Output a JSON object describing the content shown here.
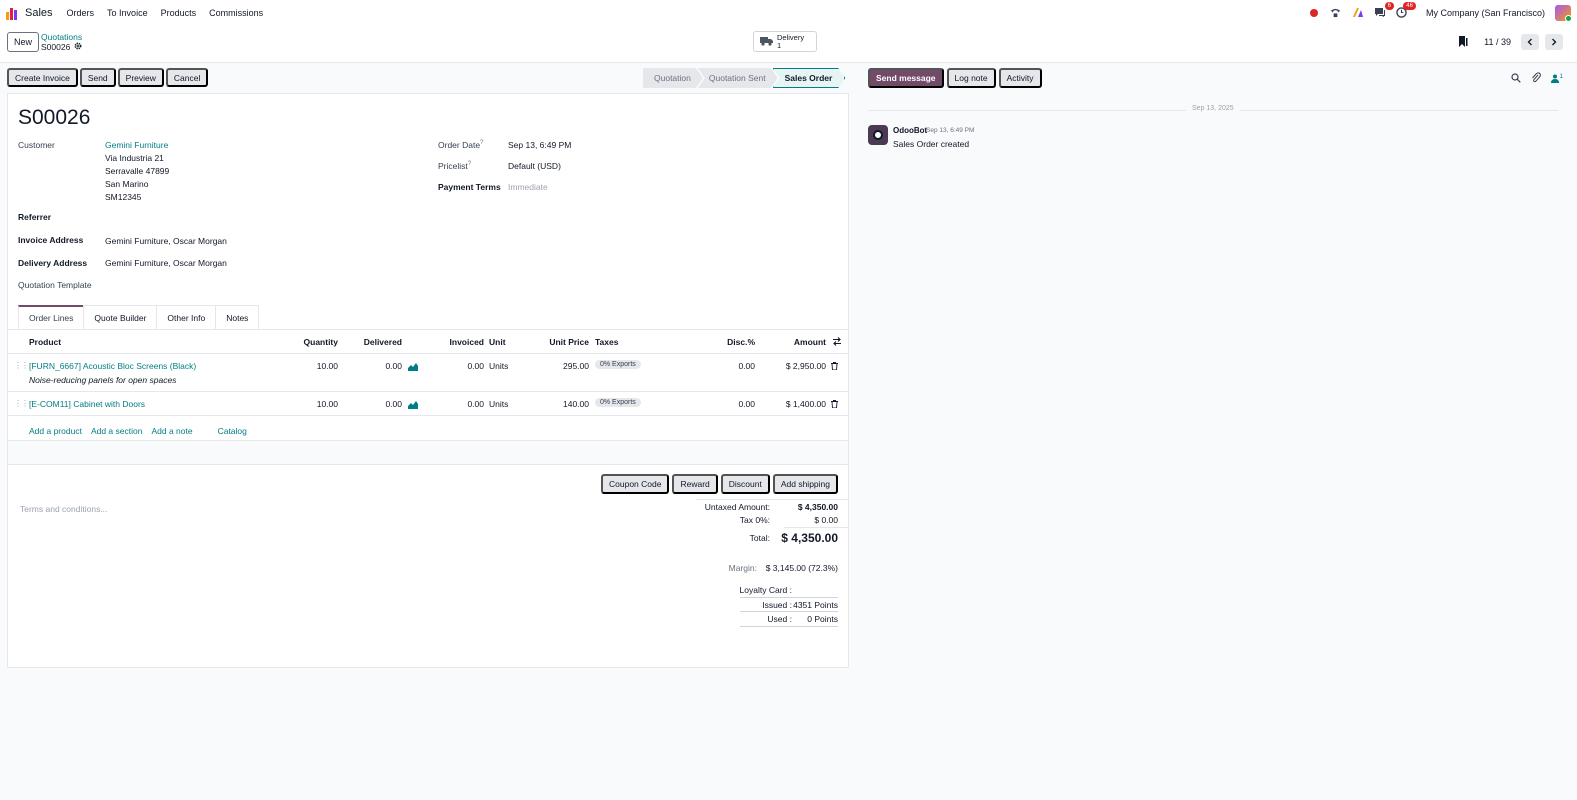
{
  "navbar": {
    "app_name": "Sales",
    "menu": [
      "Orders",
      "To Invoice",
      "Products",
      "Commissions"
    ],
    "chat_badge": "6",
    "activity_badge": "46",
    "company": "My Company (San Francisco)"
  },
  "control": {
    "new_label": "New",
    "breadcrumb_parent": "Quotations",
    "breadcrumb_current": "S00026",
    "delivery_label": "Delivery",
    "delivery_count": "1",
    "pager": "11 / 39"
  },
  "actions": {
    "create_invoice": "Create Invoice",
    "send": "Send",
    "preview": "Preview",
    "cancel": "Cancel"
  },
  "statuses": [
    "Quotation",
    "Quotation Sent",
    "Sales Order"
  ],
  "form": {
    "name": "S00026",
    "customer_label": "Customer",
    "customer_name": "Gemini Furniture",
    "customer_address": [
      "Via Industria 21",
      "Serravalle 47899",
      "San Marino",
      "SM12345"
    ],
    "referrer_label": "Referrer",
    "invoice_address_label": "Invoice Address",
    "invoice_address": "Gemini Furniture, Oscar Morgan",
    "delivery_address_label": "Delivery Address",
    "delivery_address": "Gemini Furniture, Oscar Morgan",
    "quotation_template_label": "Quotation Template",
    "order_date_label": "Order Date",
    "order_date": "Sep 13, 6:49 PM",
    "pricelist_label": "Pricelist",
    "pricelist": "Default (USD)",
    "payment_terms_label": "Payment Terms",
    "payment_terms_placeholder": "Immediate",
    "help_mark": "?"
  },
  "tabs": [
    "Order Lines",
    "Quote Builder",
    "Other Info",
    "Notes"
  ],
  "table": {
    "headers": {
      "product": "Product",
      "quantity": "Quantity",
      "delivered": "Delivered",
      "invoiced": "Invoiced",
      "unit": "Unit",
      "unit_price": "Unit Price",
      "taxes": "Taxes",
      "disc": "Disc.%",
      "amount": "Amount"
    },
    "rows": [
      {
        "product": "[FURN_6667] Acoustic Bloc Screens (Black)",
        "description": "Noise-reducing panels for open spaces",
        "quantity": "10.00",
        "delivered": "0.00",
        "invoiced": "0.00",
        "unit": "Units",
        "unit_price": "295.00",
        "tax": "0% Exports",
        "disc": "0.00",
        "amount": "$ 2,950.00"
      },
      {
        "product": "[E-COM11] Cabinet with Doors",
        "quantity": "10.00",
        "delivered": "0.00",
        "invoiced": "0.00",
        "unit": "Units",
        "unit_price": "140.00",
        "tax": "0% Exports",
        "disc": "0.00",
        "amount": "$ 1,400.00"
      }
    ],
    "add_links": [
      "Add a product",
      "Add a section",
      "Add a note",
      "Catalog"
    ]
  },
  "promo": [
    "Coupon Code",
    "Reward",
    "Discount",
    "Add shipping"
  ],
  "terms_placeholder": "Terms and conditions...",
  "totals": {
    "untaxed_label": "Untaxed Amount:",
    "untaxed": "$ 4,350.00",
    "tax_label": "Tax 0%:",
    "tax": "$ 0.00",
    "total_label": "Total:",
    "total": "$ 4,350.00",
    "margin_label": "Margin:",
    "margin": "$ 3,145.00 (72.3%)",
    "loyalty_label": "Loyalty Card :",
    "issued_label": "Issued :",
    "issued": "4351 Points",
    "used_label": "Used :",
    "used": "0 Points"
  },
  "chatter": {
    "send_message": "Send message",
    "log_note": "Log note",
    "activity": "Activity",
    "followers_count": "1",
    "date_separator": "Sep 13, 2025",
    "author": "OdooBot",
    "time": "Sep 13, 6:49 PM",
    "body": "Sales Order created"
  },
  "colors": {
    "brand": "#714b67",
    "link": "#017e84"
  }
}
